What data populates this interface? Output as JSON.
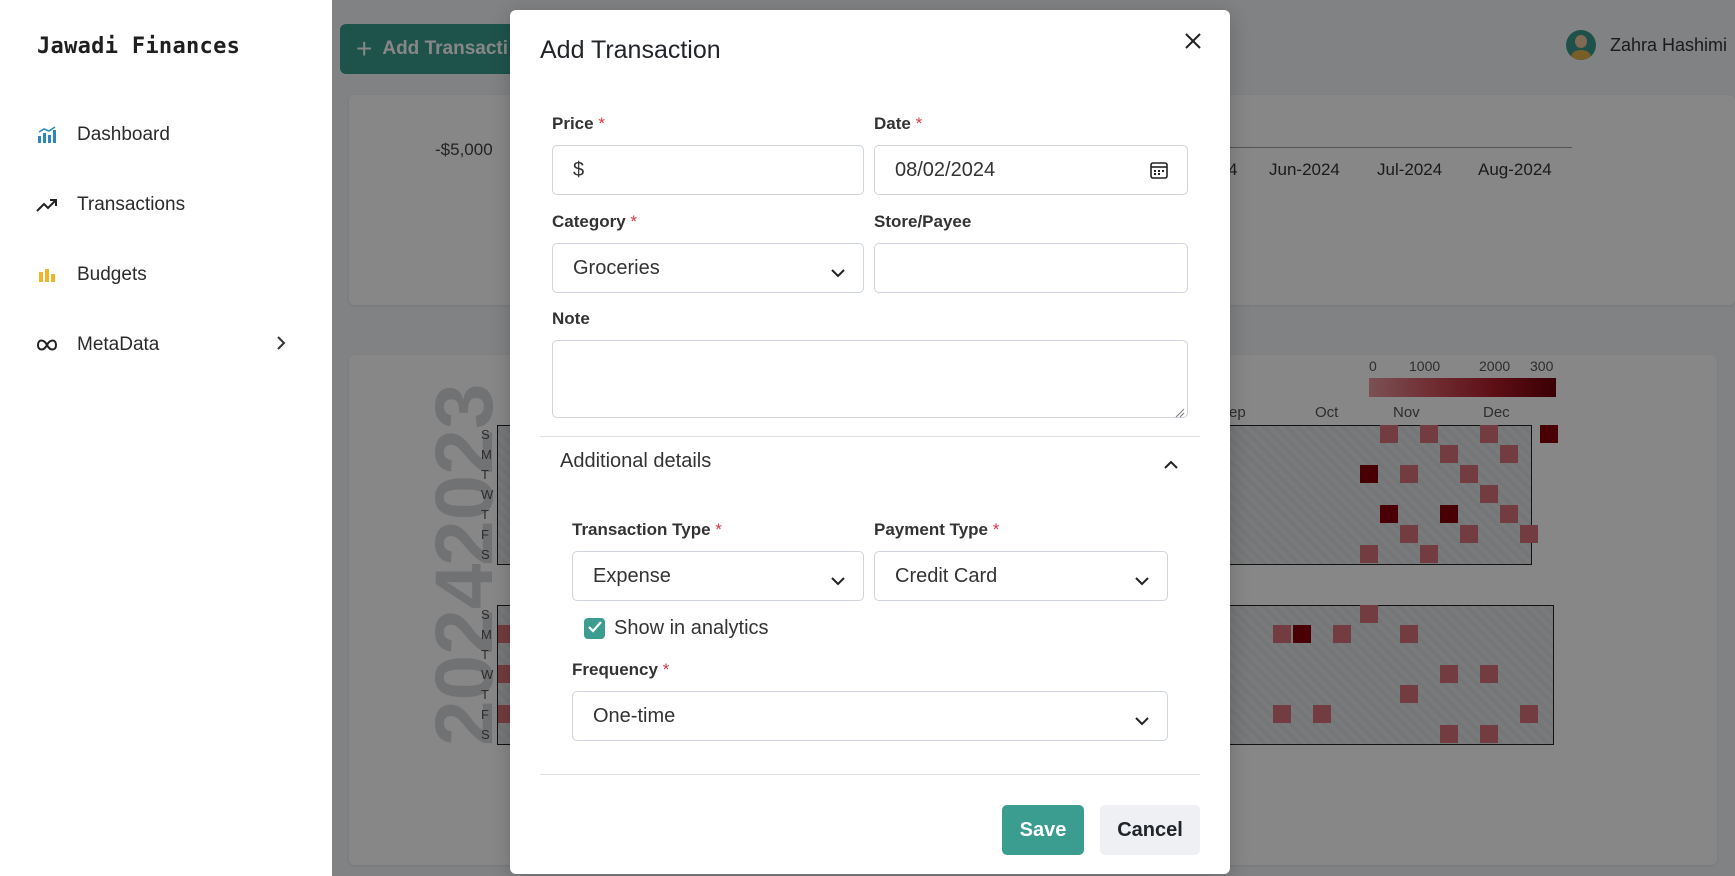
{
  "app": {
    "brand": "Jawadi Finances"
  },
  "sidebar": {
    "items": [
      {
        "label": "Dashboard",
        "icon": "chart-bar-icon"
      },
      {
        "label": "Transactions",
        "icon": "trending-up-icon"
      },
      {
        "label": "Budgets",
        "icon": "budget-bars-icon"
      },
      {
        "label": "MetaData",
        "icon": "infinity-icon"
      }
    ]
  },
  "header": {
    "add_button_label": "Add Transacti",
    "user_name": "Zahra Hashimi"
  },
  "background": {
    "neg_value": "-$5,000",
    "months": [
      "4",
      "Jun-2024",
      "Jul-2024",
      "Aug-2024"
    ],
    "years": [
      "2023",
      "2024"
    ],
    "day_letters": [
      "S",
      "M",
      "T",
      "W",
      "T",
      "F",
      "S"
    ],
    "legend_values": [
      "0",
      "1000",
      "2000",
      "300"
    ],
    "heatmap_months": [
      "ep",
      "Oct",
      "Nov",
      "Dec"
    ],
    "colors": {
      "heat_light": "#d9727a",
      "heat_mid": "#c44a55",
      "heat_dark": "#8b0008"
    }
  },
  "modal": {
    "title": "Add Transaction",
    "price": {
      "label": "Price",
      "required": "*",
      "prefix": "$"
    },
    "date": {
      "label": "Date",
      "required": "*",
      "value": "08/02/2024"
    },
    "category": {
      "label": "Category",
      "required": "*",
      "value": "Groceries"
    },
    "store": {
      "label": "Store/Payee",
      "value": ""
    },
    "note": {
      "label": "Note",
      "value": ""
    },
    "additional": {
      "title": "Additional details",
      "transaction_type": {
        "label": "Transaction Type",
        "required": "*",
        "value": "Expense"
      },
      "payment_type": {
        "label": "Payment Type",
        "required": "*",
        "value": "Credit Card"
      },
      "show_in_analytics": {
        "label": "Show in analytics",
        "checked": true
      },
      "frequency": {
        "label": "Frequency",
        "required": "*",
        "value": "One-time"
      }
    },
    "save_label": "Save",
    "cancel_label": "Cancel"
  },
  "theme": {
    "accent": "#3a9d8f",
    "required": "#dc3545"
  }
}
